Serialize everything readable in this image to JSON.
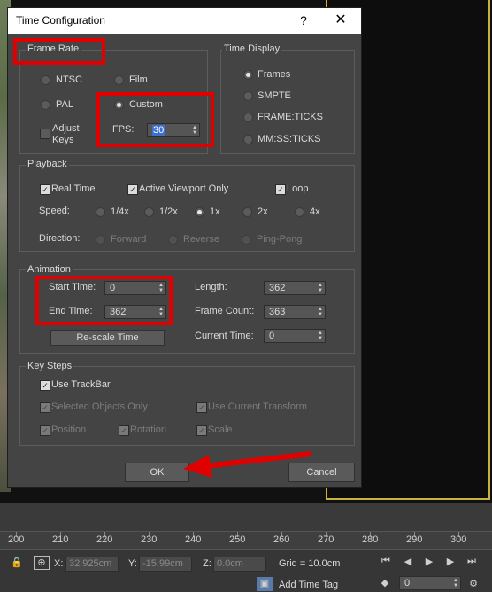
{
  "dialog": {
    "title": "Time Configuration",
    "help_label": "?",
    "close_label": "✕",
    "frame_rate": {
      "label": "Frame Rate",
      "options": [
        "NTSC",
        "Film",
        "PAL",
        "Custom"
      ],
      "selected": "Custom",
      "adjust_keys_label": "Adjust Keys",
      "adjust_keys_checked": false,
      "fps_label": "FPS:",
      "fps_value": "30"
    },
    "time_display": {
      "label": "Time Display",
      "options": [
        "Frames",
        "SMPTE",
        "FRAME:TICKS",
        "MM:SS:TICKS"
      ],
      "selected": "Frames"
    },
    "playback": {
      "label": "Playback",
      "real_time_label": "Real Time",
      "real_time_checked": true,
      "active_viewport_label": "Active Viewport Only",
      "active_viewport_checked": true,
      "loop_label": "Loop",
      "loop_checked": true,
      "speed_label": "Speed:",
      "speeds": [
        "1/4x",
        "1/2x",
        "1x",
        "2x",
        "4x"
      ],
      "speed_selected": "1x",
      "direction_label": "Direction:",
      "directions": [
        "Forward",
        "Reverse",
        "Ping-Pong"
      ]
    },
    "animation": {
      "label": "Animation",
      "start_time_label": "Start Time:",
      "start_time_value": "0",
      "end_time_label": "End Time:",
      "end_time_value": "362",
      "length_label": "Length:",
      "length_value": "362",
      "frame_count_label": "Frame Count:",
      "frame_count_value": "363",
      "current_time_label": "Current Time:",
      "current_time_value": "0",
      "rescale_label": "Re-scale Time"
    },
    "key_steps": {
      "label": "Key Steps",
      "use_trackbar_label": "Use TrackBar",
      "use_trackbar_checked": true,
      "selected_only_label": "Selected Objects Only",
      "use_current_transform_label": "Use Current Transform",
      "position_label": "Position",
      "rotation_label": "Rotation",
      "scale_label": "Scale"
    },
    "ok_label": "OK",
    "cancel_label": "Cancel"
  },
  "timeline": {
    "ticks": [
      "200",
      "210",
      "220",
      "230",
      "240",
      "250",
      "260",
      "270",
      "280",
      "290",
      "300"
    ]
  },
  "statusbar": {
    "x_label": "X:",
    "x_value": "32.925cm",
    "y_label": "Y:",
    "y_value": "-15.99cm",
    "z_label": "Z:",
    "z_value": "0.0cm",
    "grid_label": "Grid = 10.0cm",
    "add_time_tag_label": "Add Time Tag",
    "frame_value": "0"
  },
  "colors": {
    "highlight": "#e00000",
    "viewport_border": "#c8b43a"
  }
}
